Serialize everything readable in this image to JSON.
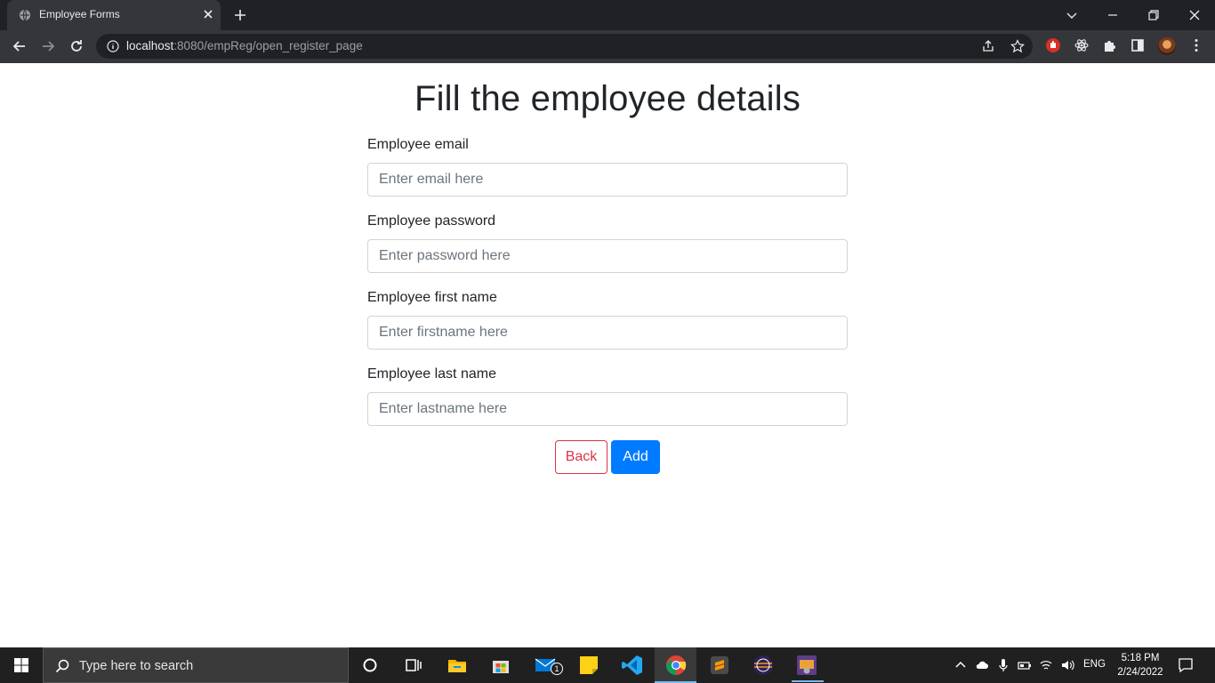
{
  "browser": {
    "tab_title": "Employee Forms",
    "url_host": "localhost",
    "url_path": ":8080/empReg/open_register_page"
  },
  "page": {
    "title": "Fill the employee details",
    "fields": [
      {
        "label": "Employee email",
        "placeholder": "Enter email here",
        "value": ""
      },
      {
        "label": "Employee password",
        "placeholder": "Enter password here",
        "value": ""
      },
      {
        "label": "Employee first name",
        "placeholder": "Enter firstname here",
        "value": ""
      },
      {
        "label": "Employee last name",
        "placeholder": "Enter lastname here",
        "value": ""
      }
    ],
    "back_label": "Back",
    "add_label": "Add"
  },
  "taskbar": {
    "search_placeholder": "Type here to search",
    "mail_badge": "1",
    "language": "ENG",
    "time": "5:18 PM",
    "date": "2/24/2022"
  },
  "colors": {
    "danger": "#dc3545",
    "primary": "#007bff",
    "chrome_dark": "#202124",
    "chrome_toolbar": "#35363a"
  },
  "icons": [
    "globe-icon",
    "close-icon",
    "plus-icon",
    "chevron-down-icon",
    "minimize-icon",
    "restore-icon",
    "back-arrow-icon",
    "forward-arrow-icon",
    "reload-icon",
    "info-icon",
    "share-icon",
    "star-icon",
    "extension-icon",
    "puzzle-icon",
    "sidepanel-icon",
    "kebab-menu-icon",
    "windows-icon",
    "search-icon",
    "cortana-icon",
    "taskview-icon",
    "folder-icon",
    "store-icon",
    "mail-icon",
    "sticky-notes-icon",
    "vscode-icon",
    "chrome-icon",
    "sublime-icon",
    "eclipse-icon",
    "app-icon",
    "chevron-up-icon",
    "cloud-icon",
    "mic-icon",
    "battery-icon",
    "wifi-icon",
    "volume-icon",
    "notification-icon"
  ]
}
